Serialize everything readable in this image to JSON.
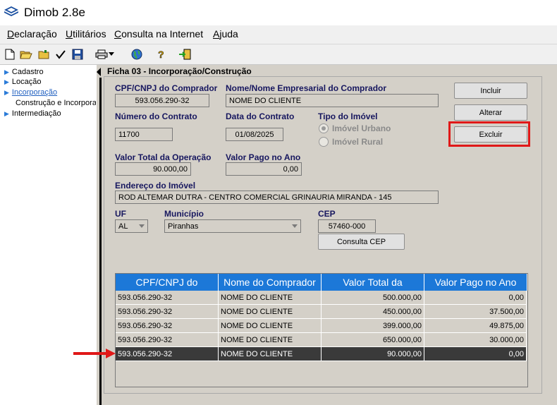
{
  "app": {
    "title": "Dimob 2.8e"
  },
  "menu": [
    {
      "label": "Declaração",
      "u": "D",
      "rest": "eclaração"
    },
    {
      "label": "Utilitários",
      "u": "U",
      "rest": "tilitários"
    },
    {
      "label": "Consulta na Internet",
      "u": "C",
      "rest": "onsulta na Internet"
    },
    {
      "label": "Ajuda",
      "u": "A",
      "rest": "juda"
    }
  ],
  "toolbar": [
    "new-icon",
    "open-icon",
    "folder-icon",
    "check-icon",
    "save-icon",
    "print-icon",
    "dropdown-arrow-icon",
    "globe-icon",
    "help-icon",
    "exit-icon"
  ],
  "tree": {
    "cadastro": "Cadastro",
    "locacao": "Locação",
    "incorporacao": "Incorporação",
    "construcao": "Construção e Incorpora",
    "intermediacao": "Intermediação"
  },
  "panel": {
    "title": "Ficha 03 - Incorporação/Construção"
  },
  "form": {
    "cpf_label": "CPF/CNPJ do Comprador",
    "cpf_value": "593.056.290-32",
    "nome_label": "Nome/Nome Empresarial do Comprador",
    "nome_value": "NOME DO CLIENTE",
    "contrato_label": "Número do Contrato",
    "contrato_value": "11700",
    "data_label": "Data do Contrato",
    "data_value": "01/08/2025",
    "tipo_label": "Tipo do Imóvel",
    "tipo_urbano": "Imóvel Urbano",
    "tipo_rural": "Imóvel Rural",
    "valor_total_label": "Valor Total da Operação",
    "valor_total_value": "90.000,00",
    "valor_pago_label": "Valor Pago no Ano",
    "valor_pago_value": "0,00",
    "endereco_label": "Endereço do Imóvel",
    "endereco_value": "ROD ALTEMAR DUTRA - CENTRO COMERCIAL GRINAURIA MIRANDA - 145",
    "uf_label": "UF",
    "uf_value": "AL",
    "municipio_label": "Município",
    "municipio_value": "Piranhas",
    "cep_label": "CEP",
    "cep_value": "57460-000"
  },
  "buttons": {
    "incluir": "Incluir",
    "alterar": "Alterar",
    "excluir": "Excluir",
    "consulta_cep": "Consulta CEP"
  },
  "table": {
    "headers": [
      "CPF/CNPJ do",
      "Nome do Comprador",
      "Valor Total da",
      "Valor Pago no Ano"
    ],
    "rows": [
      [
        "593.056.290-32",
        "NOME DO CLIENTE",
        "500.000,00",
        "0,00"
      ],
      [
        "593.056.290-32",
        "NOME DO CLIENTE",
        "450.000,00",
        "37.500,00"
      ],
      [
        "593.056.290-32",
        "NOME DO CLIENTE",
        "399.000,00",
        "49.875,00"
      ],
      [
        "593.056.290-32",
        "NOME DO CLIENTE",
        "650.000,00",
        "30.000,00"
      ],
      [
        "593.056.290-32",
        "NOME DO CLIENTE",
        "90.000,00",
        "0,00"
      ]
    ],
    "selected_row": 4
  },
  "colors": {
    "header_blue": "#1c78d8",
    "label_navy": "#17175f",
    "highlight_red": "#e01818",
    "selected_row": "#3a3a3a"
  }
}
